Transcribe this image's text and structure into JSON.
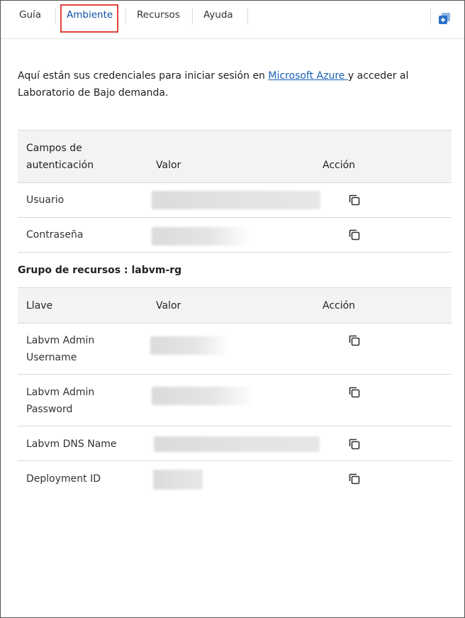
{
  "tabs": [
    {
      "label": "Guía",
      "active": false
    },
    {
      "label": "Ambiente",
      "active": true
    },
    {
      "label": "Recursos",
      "active": false
    },
    {
      "label": "Ayuda",
      "active": false
    }
  ],
  "intro": {
    "before_link": "Aquí están sus credenciales para iniciar sesión en ",
    "link_text": "Microsoft Azure ",
    "after_link": "y acceder al Laboratorio de Bajo demanda."
  },
  "auth_table": {
    "headers": {
      "field_line1": "Campos de",
      "field_line2": "autenticación",
      "value": "Valor",
      "action": "Acción"
    },
    "rows": [
      {
        "label": "Usuario"
      },
      {
        "label": "Contraseña"
      }
    ]
  },
  "resource_group": {
    "title": "Grupo de recursos : labvm-rg",
    "headers": {
      "key": "Llave",
      "value": "Valor",
      "action": "Acción"
    },
    "rows": [
      {
        "label_line1": "Labvm Admin",
        "label_line2": "Username"
      },
      {
        "label_line1": "Labvm Admin",
        "label_line2": "Password"
      },
      {
        "label_line1": "Labvm DNS Name",
        "label_line2": ""
      },
      {
        "label_line1": "Deployment ID",
        "label_line2": ""
      }
    ]
  },
  "colors": {
    "accent": "#0b4fa8",
    "highlight_box": "#e0443d",
    "link": "#1a5fb4"
  },
  "icons": {
    "popout": "popout-icon",
    "copy": "copy-icon"
  }
}
